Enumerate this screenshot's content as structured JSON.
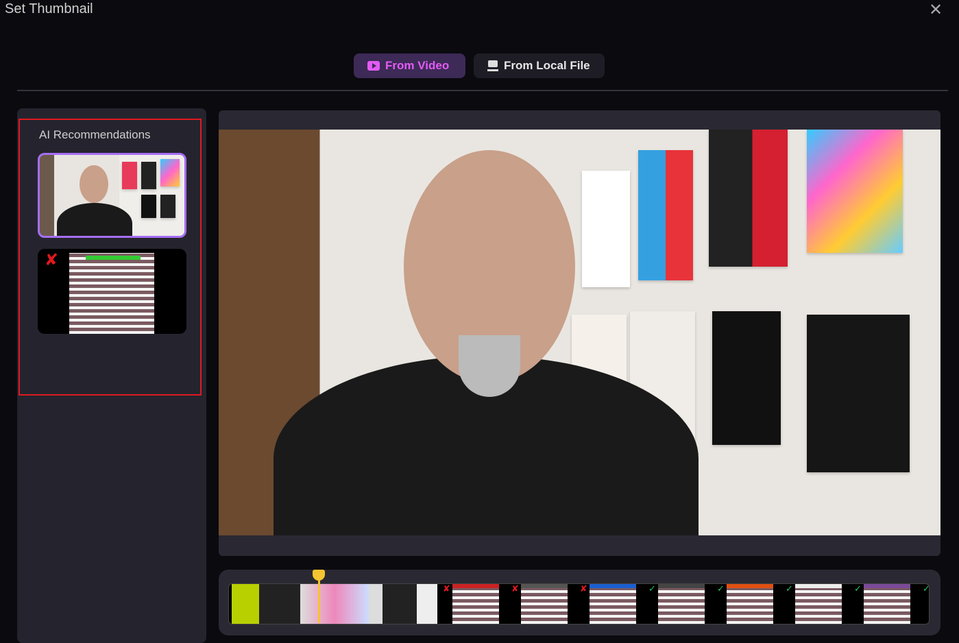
{
  "dialog": {
    "title": "Set Thumbnail",
    "close_icon": "close-icon"
  },
  "tabs": [
    {
      "label": "From Video",
      "icon": "video-play-icon",
      "active": true
    },
    {
      "label": "From Local File",
      "icon": "laptop-icon",
      "active": false
    }
  ],
  "ai_recommendations": {
    "label": "AI Recommendations",
    "items": [
      {
        "selected": true,
        "status": "recommended"
      },
      {
        "selected": false,
        "status": "rejected"
      }
    ]
  },
  "timeline": {
    "frame_marks": [
      "reject",
      "reject",
      "reject",
      "accept",
      "accept",
      "accept",
      "accept",
      "accept"
    ]
  },
  "colors": {
    "accent": "#e35bf5",
    "selection": "#a66ef5",
    "reject": "#e0191f",
    "accept": "#22c55e",
    "playhead": "#f5c430"
  }
}
